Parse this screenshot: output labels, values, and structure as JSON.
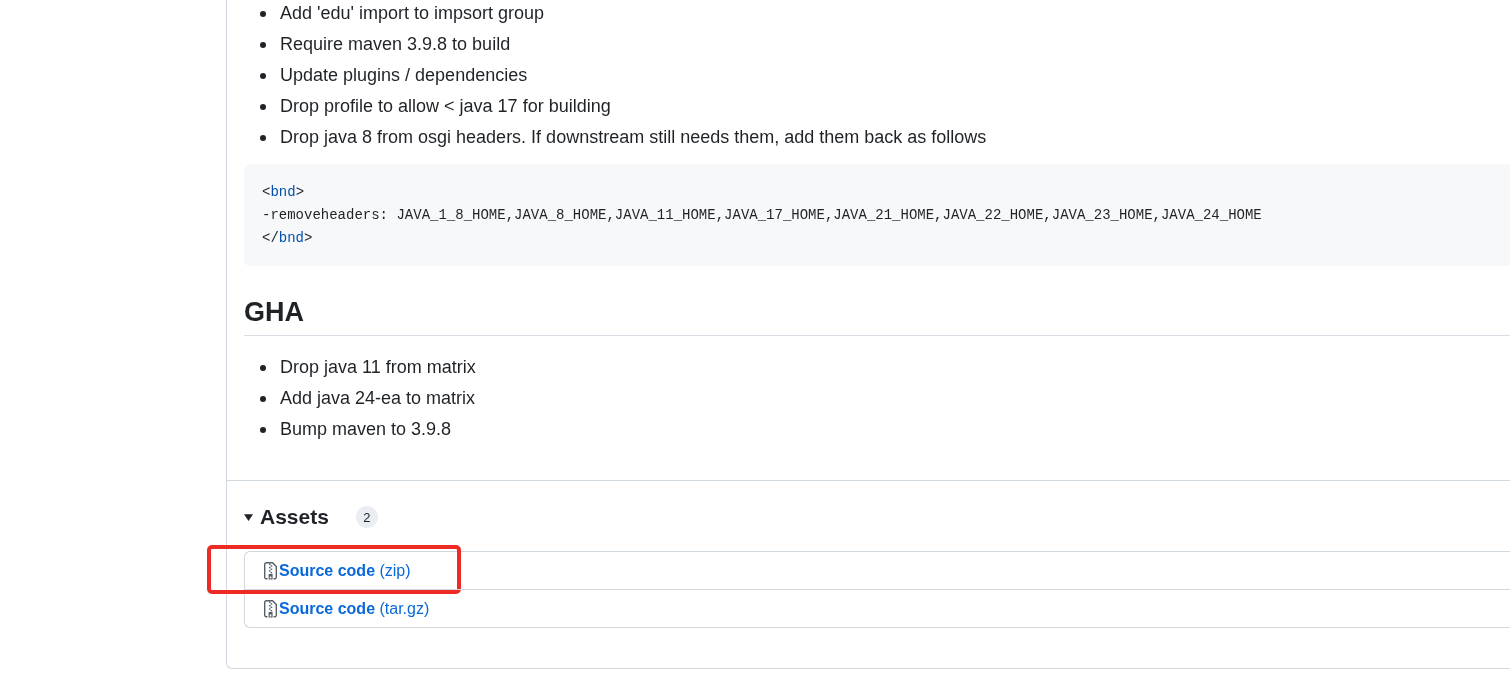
{
  "notes": {
    "items": [
      "Add 'edu' import to impsort group",
      "Require maven 3.9.8 to build",
      "Update plugins / dependencies",
      "Drop profile to allow < java 17 for building",
      "Drop java 8 from osgi headers. If downstream still needs them, add them back as follows"
    ]
  },
  "code_block": {
    "lines": [
      [
        {
          "text": "<",
          "kind": "punct"
        },
        {
          "text": "bnd",
          "kind": "tag"
        },
        {
          "text": ">",
          "kind": "punct"
        }
      ],
      [
        {
          "text": "-removeheaders: JAVA_1_8_HOME,JAVA_8_HOME,JAVA_11_HOME,JAVA_17_HOME,JAVA_21_HOME,JAVA_22_HOME,JAVA_23_HOME,JAVA_24_HOME",
          "kind": "plain"
        }
      ],
      [
        {
          "text": "</",
          "kind": "punct"
        },
        {
          "text": "bnd",
          "kind": "tag"
        },
        {
          "text": ">",
          "kind": "punct"
        }
      ]
    ]
  },
  "sections": [
    {
      "heading": "GHA",
      "items": [
        "Drop java 11 from matrix",
        "Add java 24-ea to matrix",
        "Bump maven to 3.9.8"
      ]
    }
  ],
  "assets": {
    "title": "Assets",
    "count": "2",
    "expanded": true,
    "items": [
      {
        "label": "**Source code** (zip)",
        "highlighted": true
      },
      {
        "label": "**Source code** (tar.gz)",
        "highlighted": false
      }
    ]
  }
}
